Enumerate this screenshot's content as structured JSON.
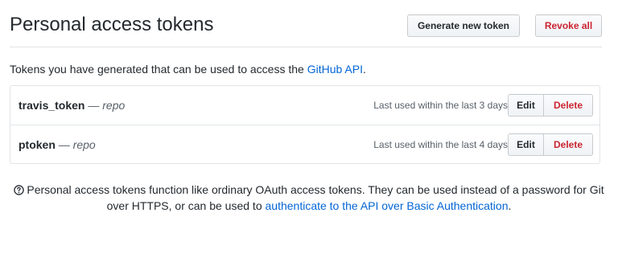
{
  "header": {
    "title": "Personal access tokens",
    "generate_label": "Generate new token",
    "revoke_label": "Revoke all"
  },
  "intro": {
    "text": "Tokens you have generated that can be used to access the ",
    "link": "GitHub API",
    "suffix": "."
  },
  "tokens": [
    {
      "name": "travis_token",
      "separator": " — ",
      "scope": "repo",
      "last_used": "Last used within the last 3 days",
      "edit_label": "Edit",
      "delete_label": "Delete"
    },
    {
      "name": "ptoken",
      "separator": " — ",
      "scope": "repo",
      "last_used": "Last used within the last 4 days",
      "edit_label": "Edit",
      "delete_label": "Delete"
    }
  ],
  "note": {
    "icon": "question-icon",
    "text": "Personal access tokens function like ordinary OAuth access tokens. They can be used instead of a password for Git over HTTPS, or can be used to ",
    "link": "authenticate to the API over Basic Authentication",
    "suffix": "."
  },
  "colors": {
    "link": "#0366d6",
    "danger": "#cb2431",
    "text": "#24292e",
    "muted": "#586069",
    "border": "#e1e4e8"
  }
}
